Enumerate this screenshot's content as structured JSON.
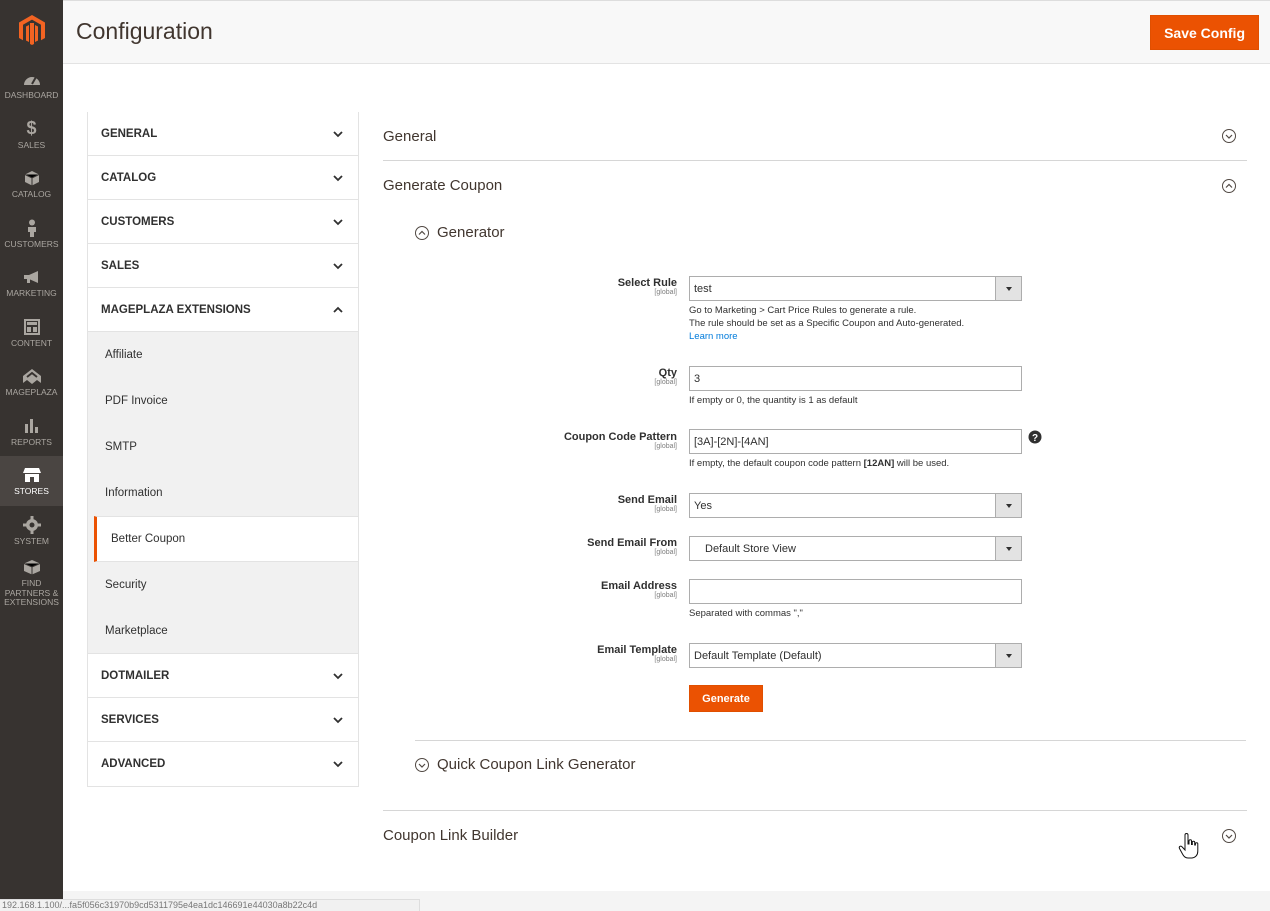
{
  "menu": {
    "items": [
      {
        "label": "DASHBOARD",
        "icon": "dashboard-icon"
      },
      {
        "label": "SALES",
        "icon": "dollar-icon"
      },
      {
        "label": "CATALOG",
        "icon": "box-icon"
      },
      {
        "label": "CUSTOMERS",
        "icon": "person-icon"
      },
      {
        "label": "MARKETING",
        "icon": "megaphone-icon"
      },
      {
        "label": "CONTENT",
        "icon": "layout-icon"
      },
      {
        "label": "MAGEPLAZA",
        "icon": "mageplaza-icon"
      },
      {
        "label": "REPORTS",
        "icon": "bar-chart-icon"
      },
      {
        "label": "STORES",
        "icon": "store-icon"
      },
      {
        "label": "SYSTEM",
        "icon": "gear-icon"
      },
      {
        "label": "FIND PARTNERS & EXTENSIONS",
        "icon": "partners-icon"
      }
    ],
    "active": "STORES"
  },
  "header": {
    "title": "Configuration",
    "save_label": "Save Config"
  },
  "nav": {
    "tabs": [
      {
        "label": "GENERAL"
      },
      {
        "label": "CATALOG"
      },
      {
        "label": "CUSTOMERS"
      },
      {
        "label": "SALES"
      },
      {
        "label": "MAGEPLAZA EXTENSIONS"
      },
      {
        "label": "DOTMAILER"
      },
      {
        "label": "SERVICES"
      },
      {
        "label": "ADVANCED"
      }
    ],
    "mageplaza_items": [
      "Affiliate",
      "PDF Invoice",
      "SMTP",
      "Information",
      "Better Coupon",
      "Security",
      "Marketplace"
    ],
    "current_item": "Better Coupon"
  },
  "main": {
    "sections": {
      "general": "General",
      "generate_coupon": "Generate Coupon",
      "coupon_link_builder": "Coupon Link Builder"
    },
    "groups": {
      "generator": "Generator",
      "quick_link": "Quick Coupon Link Generator"
    },
    "scope": "[global]",
    "fields": {
      "select_rule": {
        "label": "Select Rule",
        "value": "test",
        "note1": "Go to Marketing > Cart Price Rules to generate a rule.",
        "note2": "The rule should be set as a Specific Coupon and Auto-generated.",
        "link": "Learn more"
      },
      "qty": {
        "label": "Qty",
        "value": "3",
        "note": "If empty or 0, the quantity is 1 as default"
      },
      "pattern": {
        "label": "Coupon Code Pattern",
        "value": "[3A]-[2N]-[4AN]",
        "note_pre": "If empty, the default coupon code pattern ",
        "note_bold": "[12AN]",
        "note_post": " will be used."
      },
      "send_email": {
        "label": "Send Email",
        "value": "Yes"
      },
      "send_from": {
        "label": "Send Email From",
        "value": "Default Store View"
      },
      "email_address": {
        "label": "Email Address",
        "value": "",
        "note": "Separated with commas \",\""
      },
      "email_template": {
        "label": "Email Template",
        "value": "Default Template (Default)"
      }
    },
    "generate_label": "Generate"
  },
  "status_bar": {
    "text": "192.168.1.100/...fa5f056c31970b9cd5311795e4ea1dc146691e44030a8b22c4d"
  },
  "colors": {
    "accent": "#eb5202",
    "sidebar": "#373330",
    "link": "#007bdb"
  }
}
